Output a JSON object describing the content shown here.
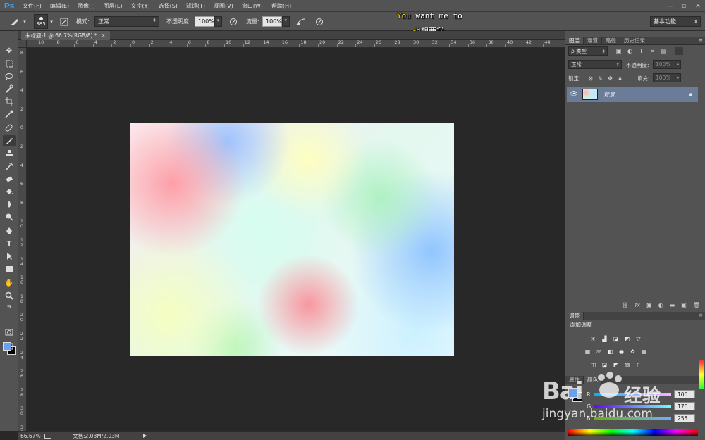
{
  "app": {
    "logo": "Ps"
  },
  "menu": [
    "文件(F)",
    "编辑(E)",
    "图像(I)",
    "图层(L)",
    "文字(Y)",
    "选择(S)",
    "滤镜(T)",
    "视图(V)",
    "窗口(W)",
    "帮助(H)"
  ],
  "window_controls": [
    "—",
    "▫",
    "✕"
  ],
  "options": {
    "brush_size": "385",
    "mode_label": "模式:",
    "mode_value": "正常",
    "opacity_label": "不透明度:",
    "opacity_value": "100%",
    "flow_label": "流量:",
    "flow_value": "100%",
    "workspace": "基本功能"
  },
  "caption": {
    "line1_a": "You",
    "line1_b": " want me to",
    "line2_a": "也",
    "line2_b": "想要我"
  },
  "document": {
    "tab_title": "未标题-1 @ 66.7%(RGB/8) *",
    "close": "×"
  },
  "ruler_top": [
    "10",
    "8",
    "6",
    "4",
    "2",
    "0",
    "2",
    "4",
    "6",
    "8",
    "10",
    "12",
    "14",
    "16",
    "18",
    "20",
    "22",
    "24",
    "26",
    "28",
    "30",
    "32",
    "34",
    "36",
    "38",
    "40",
    "42",
    "44"
  ],
  "ruler_left": [
    "8",
    "6",
    "4",
    "2",
    "0",
    "2",
    "4",
    "6",
    "8",
    "1 0",
    "1 2",
    "1 4",
    "1 6",
    "1 8",
    "2 0",
    "2 2",
    "2 4",
    "2 6",
    "2 8",
    "3 0",
    "3 2"
  ],
  "status": {
    "zoom": "66.67%",
    "doc_info": "文档:2.03M/2.03M",
    "arrow": "▶"
  },
  "layers_panel": {
    "tabs": [
      "图层",
      "通道",
      "路径",
      "历史记录"
    ],
    "filter_label": "ρ 类型",
    "blend_mode": "正常",
    "opacity_label": "不透明度:",
    "opacity_value": "100%",
    "lock_label": "锁定:",
    "fill_label": "填充:",
    "fill_value": "100%",
    "layer_name": "背景"
  },
  "adjustments_panel": {
    "tab": "调整",
    "title": "添加调整"
  },
  "color_panel": {
    "tabs": [
      "属性",
      "颜色"
    ],
    "channels": [
      {
        "label": "R",
        "value": "106"
      },
      {
        "label": "G",
        "value": "176"
      },
      {
        "label": "B",
        "value": "255"
      }
    ],
    "foreground": "#6aa0f0",
    "background": "#000000"
  },
  "watermark": {
    "brand": "Bai",
    "brand2": "经验",
    "url": "jingyan.baidu.com"
  },
  "icons": {
    "tools": [
      "move-icon",
      "marquee-icon",
      "lasso-icon",
      "quick-select-icon",
      "crop-icon",
      "eyedropper-icon",
      "healing-brush-icon",
      "brush-icon",
      "clone-stamp-icon",
      "history-brush-icon",
      "eraser-icon",
      "paint-bucket-icon",
      "blur-icon",
      "dodge-icon",
      "pen-icon",
      "type-icon",
      "path-select-icon",
      "rectangle-icon",
      "hand-icon",
      "zoom-icon"
    ]
  }
}
